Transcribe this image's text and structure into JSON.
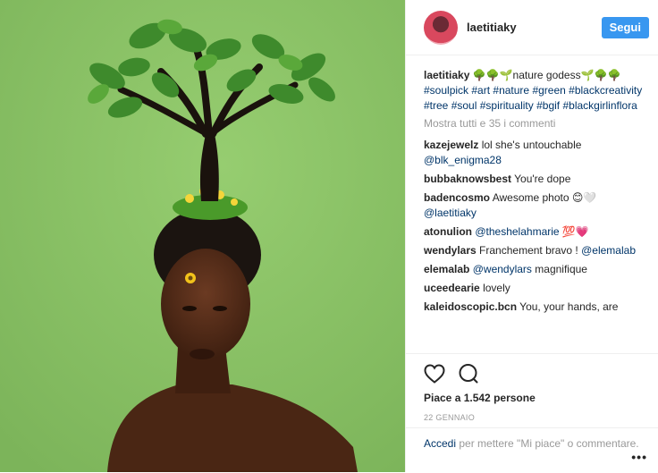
{
  "post": {
    "username": "laetitiaky",
    "follow_label": "Segui",
    "caption": {
      "user": "laetitiaky",
      "text": "🌳🌳🌱nature godess🌱🌳🌳",
      "hashtags": [
        "#soulpick",
        "#art",
        "#nature",
        "#green",
        "#blackcreativity",
        "#tree",
        "#soul",
        "#spirituality",
        "#bgif",
        "#blackgirlinflora"
      ]
    },
    "show_all_comments": "Mostra tutti e 35 i commenti",
    "comments": [
      {
        "user": "kazejewelz",
        "text": "lol she's untouchable ",
        "mention": "@blk_enigma28"
      },
      {
        "user": "bubbaknowsbest",
        "text": "You're dope",
        "mention": ""
      },
      {
        "user": "badencosmo",
        "text": "Awesome photo 😊🤍 ",
        "mention": "@laetitiaky"
      },
      {
        "user": "atonulion",
        "text": "",
        "mention": "@theshelahmarie",
        "tail": " 💯💗"
      },
      {
        "user": "wendylars",
        "text": "Franchement bravo ! ",
        "mention": "@elemalab"
      },
      {
        "user": "elemalab",
        "text": "",
        "mention": "@wendylars",
        "tail": " magnifique"
      },
      {
        "user": "uceedearie",
        "text": "lovely",
        "mention": ""
      },
      {
        "user": "kaleidoscopic.bcn",
        "text": "You, your hands, are",
        "mention": ""
      }
    ],
    "likes": "Piace a 1.542 persone",
    "date": "22 GENNAIO",
    "add_comment": {
      "link": "Accedi",
      "rest": " per mettere \"Mi piace\" o commentare."
    },
    "more_icon": "ellipsis-icon",
    "icons": {
      "like": "heart-icon",
      "comment": "comment-bubble-icon"
    }
  }
}
